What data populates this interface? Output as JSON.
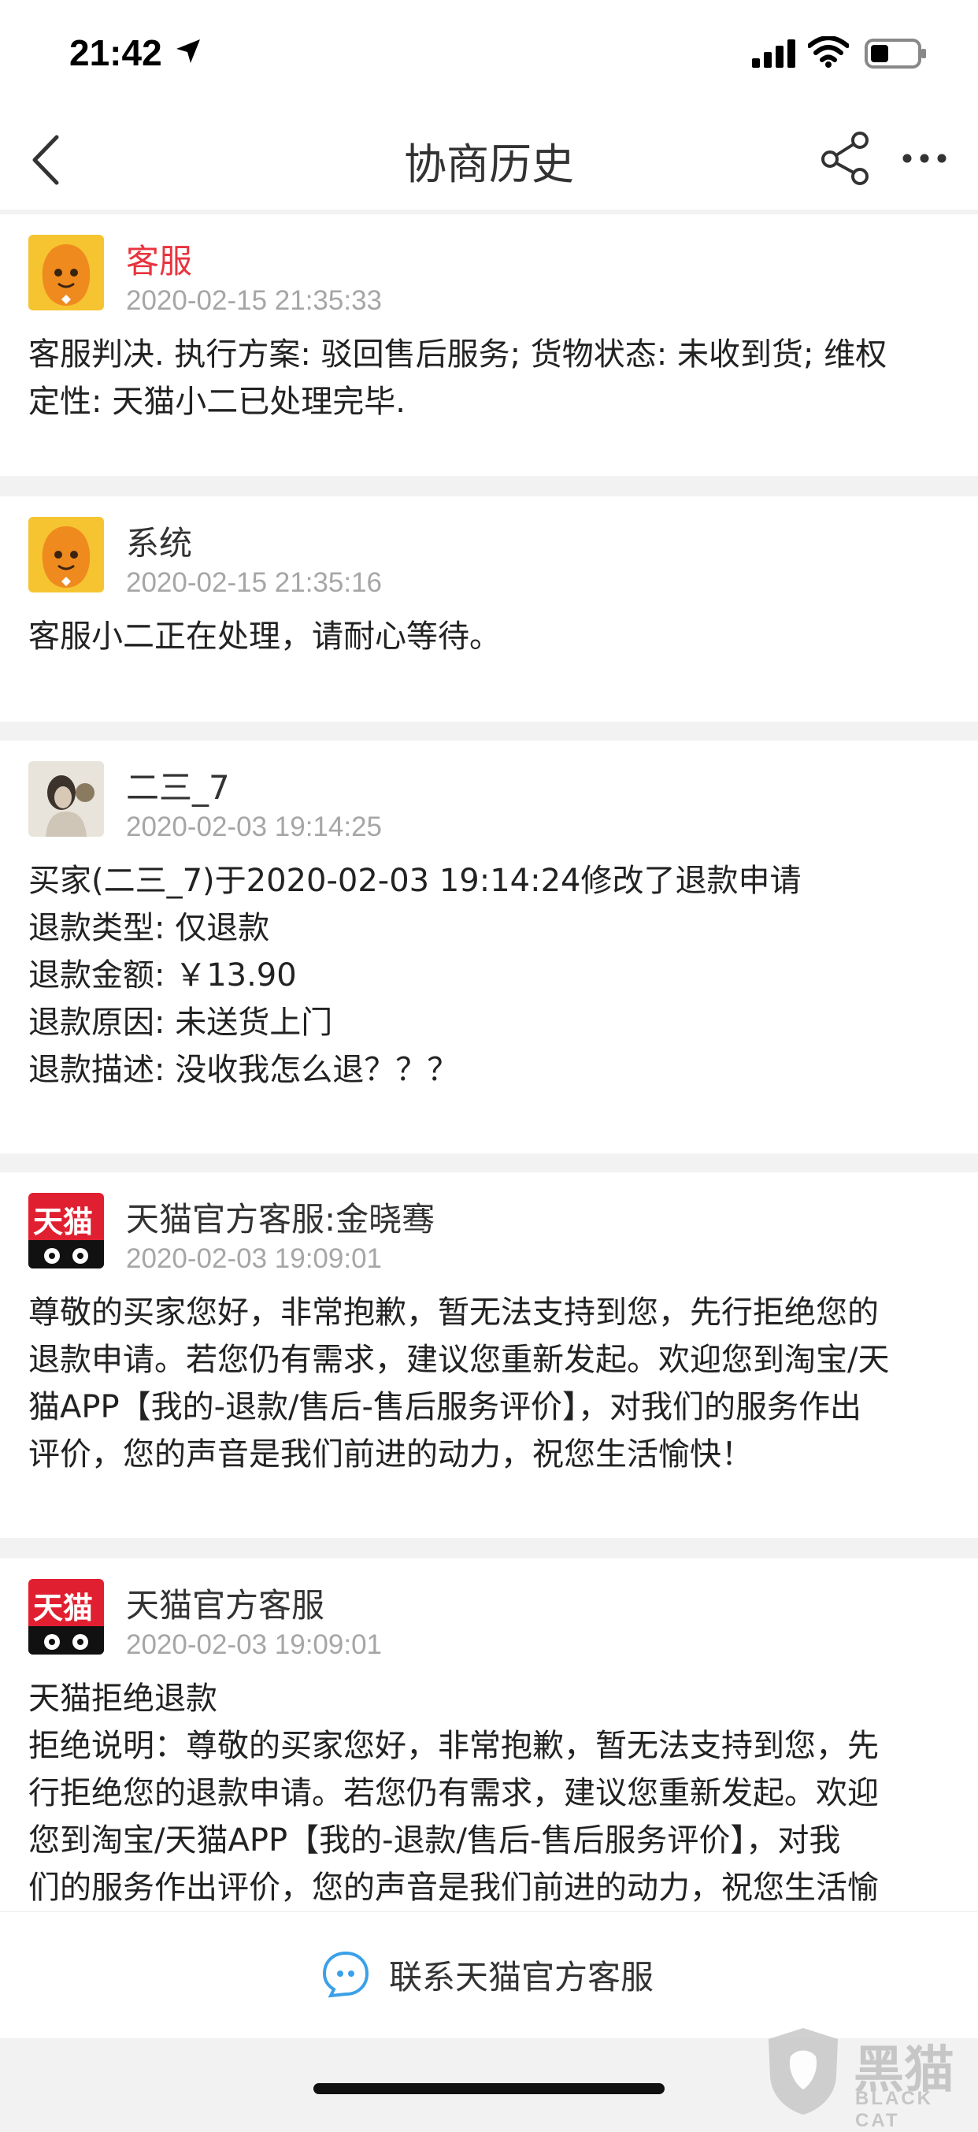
{
  "status_bar": {
    "time": "21:42"
  },
  "nav": {
    "title": "协商历史"
  },
  "colors": {
    "accent_red": "#e8343f",
    "timestamp_gray": "#a6a6a6",
    "tmall_red": "#e02030"
  },
  "records": [
    {
      "avatar": "orange-mascot-avatar",
      "name": "客服",
      "time": "2020-02-15 21:35:33",
      "lines": [
        "客服判决. 执行方案: 驳回售后服务; 货物状态: 未收到货; 维权",
        "定性: 天猫小二已处理完毕."
      ]
    },
    {
      "avatar": "orange-mascot-avatar",
      "name": "系统",
      "time": "2020-02-15 21:35:16",
      "lines": [
        "客服小二正在处理，请耐心等待。"
      ]
    },
    {
      "avatar": "user-photo-avatar",
      "name": "二三_7",
      "time": "2020-02-03 19:14:25",
      "lines": [
        "买家(二三_7)于2020-02-03 19:14:24修改了退款申请",
        "退款类型: 仅退款",
        "退款金额: ￥13.90",
        "退款原因: 未送货上门",
        "退款描述: 没收我怎么退？？？"
      ]
    },
    {
      "avatar": "tmall-logo-avatar",
      "avatar_text": "天猫",
      "name": "天猫官方客服:金晓骞",
      "time": "2020-02-03 19:09:01",
      "lines": [
        "尊敬的买家您好，非常抱歉，暂无法支持到您，先行拒绝您的",
        "退款申请。若您仍有需求，建议您重新发起。欢迎您到淘宝/天",
        "猫APP【我的-退款/售后-售后服务评价】，对我们的服务作出",
        "评价，您的声音是我们前进的动力，祝您生活愉快！"
      ]
    },
    {
      "avatar": "tmall-logo-avatar",
      "avatar_text": "天猫",
      "name": "天猫官方客服",
      "time": "2020-02-03 19:09:01",
      "lines": [
        "天猫拒绝退款",
        "拒绝说明：尊敬的买家您好，非常抱歉，暂无法支持到您，先",
        "行拒绝您的退款申请。若您仍有需求，建议您重新发起。欢迎",
        "您到淘宝/天猫APP【我的-退款/售后-售后服务评价】，对我",
        "们的服务作出评价，您的声音是我们前进的动力，祝您生活愉"
      ]
    }
  ],
  "bottom_bar": {
    "contact_label": "联系天猫官方客服"
  },
  "watermark": {
    "text": "黑猫",
    "sub": "BLACK CAT"
  }
}
